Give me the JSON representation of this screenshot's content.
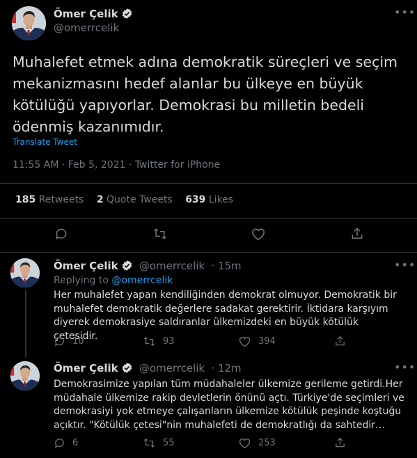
{
  "main_tweet": {
    "author_name": "Ömer Çelik",
    "author_handle": "@omerrcelik",
    "text": "Muhalefet etmek adına demokratik süreçleri ve seçim mekanizmasını hedef alanlar bu ülkeye en büyük kötülüğü yapıyorlar. Demokrasi bu milletin bedeli ödenmiş kazanımıdır.",
    "translate_label": "Translate Tweet",
    "meta": "11:55 AM · Feb 5, 2021 · Twitter for iPhone",
    "retweets_count": "185",
    "retweets_label": "Retweets",
    "quote_count": "2",
    "quote_label": "Quote Tweets",
    "likes_count": "639",
    "likes_label": "Likes"
  },
  "replies": [
    {
      "author_name": "Ömer Çelik",
      "author_handle": "@omerrcelik",
      "time": "· 15m",
      "replying_prefix": "Replying to",
      "replying_handle": "@omerrcelik",
      "text": "Her muhalefet yapan kendiliğinden demokrat olmuyor. Demokratik bir muhalefet demokratik değerlere sadakat gerektirir. İktidara karşıyım diyerek demokrasiye saldıranlar ülkemizdeki en büyük kötülük çetesidir.",
      "reply_count": "10",
      "retweet_count": "93",
      "like_count": "394"
    },
    {
      "author_name": "Ömer Çelik",
      "author_handle": "@omerrcelik",
      "time": "· 12m",
      "text": "Demokrasimize yapılan tüm müdahaleler ülkemize gerileme getirdi.Her müdahale ülkemize rakip devletlerin önünü açtı. Türkiye'de seçimleri ve demokrasiyi yok etmeye çalışanların ülkemize kötülük peşinde koştuğu açıktır. \"Kötülük çetesi\"nin muhalefeti de demokratlığı da sahtedir…",
      "reply_count": "6",
      "retweet_count": "55",
      "like_count": "253"
    }
  ],
  "colors": {
    "background": "#000000",
    "text": "#d9d9d9",
    "muted": "#6e767d",
    "link": "#1da1f2",
    "divider": "#2f3336"
  }
}
